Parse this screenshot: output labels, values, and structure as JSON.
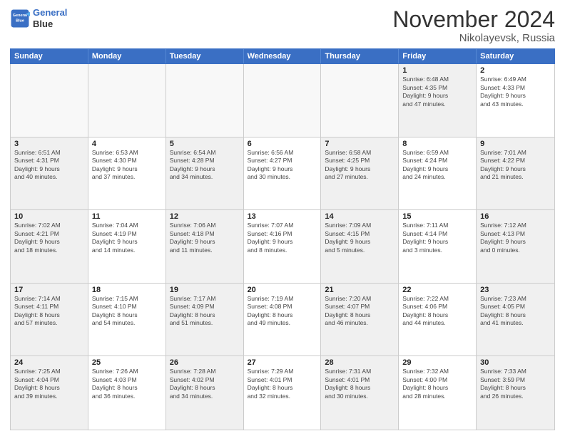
{
  "header": {
    "logo_line1": "General",
    "logo_line2": "Blue",
    "month_title": "November 2024",
    "location": "Nikolayevsk, Russia"
  },
  "weekdays": [
    "Sunday",
    "Monday",
    "Tuesday",
    "Wednesday",
    "Thursday",
    "Friday",
    "Saturday"
  ],
  "rows": [
    [
      {
        "day": "",
        "info": "",
        "empty": true
      },
      {
        "day": "",
        "info": "",
        "empty": true
      },
      {
        "day": "",
        "info": "",
        "empty": true
      },
      {
        "day": "",
        "info": "",
        "empty": true
      },
      {
        "day": "",
        "info": "",
        "empty": true
      },
      {
        "day": "1",
        "info": "Sunrise: 6:48 AM\nSunset: 4:35 PM\nDaylight: 9 hours\nand 47 minutes.",
        "shaded": true
      },
      {
        "day": "2",
        "info": "Sunrise: 6:49 AM\nSunset: 4:33 PM\nDaylight: 9 hours\nand 43 minutes.",
        "shaded": false
      }
    ],
    [
      {
        "day": "3",
        "info": "Sunrise: 6:51 AM\nSunset: 4:31 PM\nDaylight: 9 hours\nand 40 minutes.",
        "shaded": true
      },
      {
        "day": "4",
        "info": "Sunrise: 6:53 AM\nSunset: 4:30 PM\nDaylight: 9 hours\nand 37 minutes.",
        "shaded": false
      },
      {
        "day": "5",
        "info": "Sunrise: 6:54 AM\nSunset: 4:28 PM\nDaylight: 9 hours\nand 34 minutes.",
        "shaded": true
      },
      {
        "day": "6",
        "info": "Sunrise: 6:56 AM\nSunset: 4:27 PM\nDaylight: 9 hours\nand 30 minutes.",
        "shaded": false
      },
      {
        "day": "7",
        "info": "Sunrise: 6:58 AM\nSunset: 4:25 PM\nDaylight: 9 hours\nand 27 minutes.",
        "shaded": true
      },
      {
        "day": "8",
        "info": "Sunrise: 6:59 AM\nSunset: 4:24 PM\nDaylight: 9 hours\nand 24 minutes.",
        "shaded": false
      },
      {
        "day": "9",
        "info": "Sunrise: 7:01 AM\nSunset: 4:22 PM\nDaylight: 9 hours\nand 21 minutes.",
        "shaded": true
      }
    ],
    [
      {
        "day": "10",
        "info": "Sunrise: 7:02 AM\nSunset: 4:21 PM\nDaylight: 9 hours\nand 18 minutes.",
        "shaded": true
      },
      {
        "day": "11",
        "info": "Sunrise: 7:04 AM\nSunset: 4:19 PM\nDaylight: 9 hours\nand 14 minutes.",
        "shaded": false
      },
      {
        "day": "12",
        "info": "Sunrise: 7:06 AM\nSunset: 4:18 PM\nDaylight: 9 hours\nand 11 minutes.",
        "shaded": true
      },
      {
        "day": "13",
        "info": "Sunrise: 7:07 AM\nSunset: 4:16 PM\nDaylight: 9 hours\nand 8 minutes.",
        "shaded": false
      },
      {
        "day": "14",
        "info": "Sunrise: 7:09 AM\nSunset: 4:15 PM\nDaylight: 9 hours\nand 5 minutes.",
        "shaded": true
      },
      {
        "day": "15",
        "info": "Sunrise: 7:11 AM\nSunset: 4:14 PM\nDaylight: 9 hours\nand 3 minutes.",
        "shaded": false
      },
      {
        "day": "16",
        "info": "Sunrise: 7:12 AM\nSunset: 4:13 PM\nDaylight: 9 hours\nand 0 minutes.",
        "shaded": true
      }
    ],
    [
      {
        "day": "17",
        "info": "Sunrise: 7:14 AM\nSunset: 4:11 PM\nDaylight: 8 hours\nand 57 minutes.",
        "shaded": true
      },
      {
        "day": "18",
        "info": "Sunrise: 7:15 AM\nSunset: 4:10 PM\nDaylight: 8 hours\nand 54 minutes.",
        "shaded": false
      },
      {
        "day": "19",
        "info": "Sunrise: 7:17 AM\nSunset: 4:09 PM\nDaylight: 8 hours\nand 51 minutes.",
        "shaded": true
      },
      {
        "day": "20",
        "info": "Sunrise: 7:19 AM\nSunset: 4:08 PM\nDaylight: 8 hours\nand 49 minutes.",
        "shaded": false
      },
      {
        "day": "21",
        "info": "Sunrise: 7:20 AM\nSunset: 4:07 PM\nDaylight: 8 hours\nand 46 minutes.",
        "shaded": true
      },
      {
        "day": "22",
        "info": "Sunrise: 7:22 AM\nSunset: 4:06 PM\nDaylight: 8 hours\nand 44 minutes.",
        "shaded": false
      },
      {
        "day": "23",
        "info": "Sunrise: 7:23 AM\nSunset: 4:05 PM\nDaylight: 8 hours\nand 41 minutes.",
        "shaded": true
      }
    ],
    [
      {
        "day": "24",
        "info": "Sunrise: 7:25 AM\nSunset: 4:04 PM\nDaylight: 8 hours\nand 39 minutes.",
        "shaded": true
      },
      {
        "day": "25",
        "info": "Sunrise: 7:26 AM\nSunset: 4:03 PM\nDaylight: 8 hours\nand 36 minutes.",
        "shaded": false
      },
      {
        "day": "26",
        "info": "Sunrise: 7:28 AM\nSunset: 4:02 PM\nDaylight: 8 hours\nand 34 minutes.",
        "shaded": true
      },
      {
        "day": "27",
        "info": "Sunrise: 7:29 AM\nSunset: 4:01 PM\nDaylight: 8 hours\nand 32 minutes.",
        "shaded": false
      },
      {
        "day": "28",
        "info": "Sunrise: 7:31 AM\nSunset: 4:01 PM\nDaylight: 8 hours\nand 30 minutes.",
        "shaded": true
      },
      {
        "day": "29",
        "info": "Sunrise: 7:32 AM\nSunset: 4:00 PM\nDaylight: 8 hours\nand 28 minutes.",
        "shaded": false
      },
      {
        "day": "30",
        "info": "Sunrise: 7:33 AM\nSunset: 3:59 PM\nDaylight: 8 hours\nand 26 minutes.",
        "shaded": true
      }
    ]
  ]
}
